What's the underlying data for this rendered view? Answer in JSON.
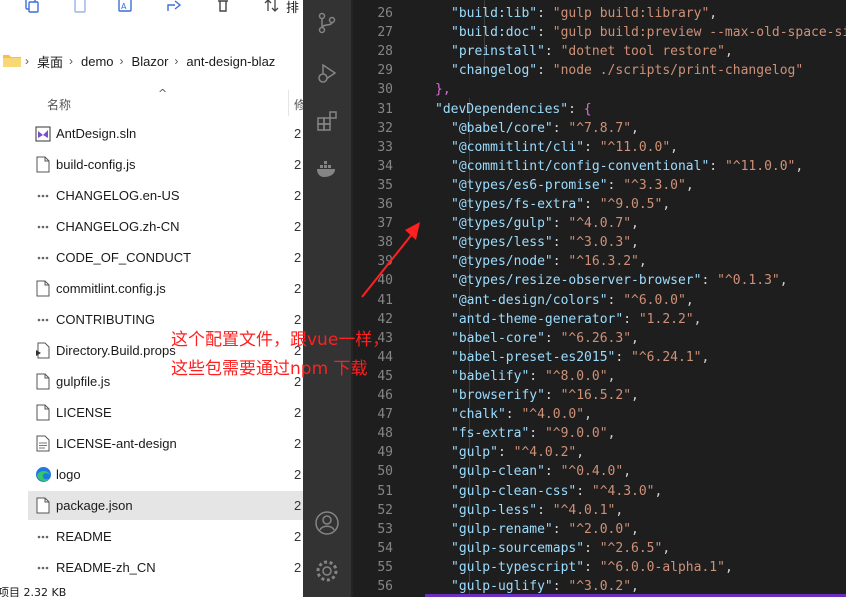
{
  "explorer": {
    "toolbar": {
      "sort_label": "排"
    },
    "breadcrumb": [
      "桌面",
      "demo",
      "Blazor",
      "ant-design-blaz"
    ],
    "column_name": "名称",
    "column_modified": "修",
    "files": [
      {
        "name": "AntDesign.sln",
        "icon": "vs-solution-icon",
        "date": "2"
      },
      {
        "name": "build-config.js",
        "icon": "file-icon",
        "date": "2"
      },
      {
        "name": "CHANGELOG.en-US",
        "icon": "text-file-icon",
        "date": "2"
      },
      {
        "name": "CHANGELOG.zh-CN",
        "icon": "text-file-icon",
        "date": "2"
      },
      {
        "name": "CODE_OF_CONDUCT",
        "icon": "text-file-icon",
        "date": "2"
      },
      {
        "name": "commitlint.config.js",
        "icon": "file-icon",
        "date": "2"
      },
      {
        "name": "CONTRIBUTING",
        "icon": "text-file-icon",
        "date": "2"
      },
      {
        "name": "Directory.Build.props",
        "icon": "props-file-icon",
        "date": "2"
      },
      {
        "name": "gulpfile.js",
        "icon": "file-icon",
        "date": "2"
      },
      {
        "name": "LICENSE",
        "icon": "file-icon",
        "date": "2"
      },
      {
        "name": "LICENSE-ant-design",
        "icon": "doc-file-icon",
        "date": "2"
      },
      {
        "name": "logo",
        "icon": "edge-icon",
        "date": "2"
      },
      {
        "name": "package.json",
        "icon": "file-icon",
        "date": "2",
        "selected": true
      },
      {
        "name": "README",
        "icon": "text-file-icon",
        "date": "2"
      },
      {
        "name": "README-zh_CN",
        "icon": "text-file-icon",
        "date": "2"
      }
    ],
    "status": "项目 2.32 KB"
  },
  "vscode": {
    "lines": [
      {
        "n": "26",
        "key": "\"build:lib\"",
        "val": "\"gulp build:library\"",
        "tail": ","
      },
      {
        "n": "27",
        "key": "\"build:doc\"",
        "val": "\"gulp build:preview --max-old-space-siz",
        "tail": ""
      },
      {
        "n": "28",
        "key": "\"preinstall\"",
        "val": "\"dotnet tool restore\"",
        "tail": ","
      },
      {
        "n": "29",
        "key": "\"changelog\"",
        "val": "\"node ./scripts/print-changelog\"",
        "tail": ""
      },
      {
        "n": "30",
        "raw": "},",
        "rawclass": "brace",
        "indent": 0
      },
      {
        "n": "31",
        "key": "\"devDependencies\"",
        "val": "{",
        "valclass": "brace",
        "tail": "",
        "indent": 0
      },
      {
        "n": "32",
        "key": "\"@babel/core\"",
        "val": "\"^7.8.7\"",
        "tail": ","
      },
      {
        "n": "33",
        "key": "\"@commitlint/cli\"",
        "val": "\"^11.0.0\"",
        "tail": ","
      },
      {
        "n": "34",
        "key": "\"@commitlint/config-conventional\"",
        "val": "\"^11.0.0\"",
        "tail": ","
      },
      {
        "n": "35",
        "key": "\"@types/es6-promise\"",
        "val": "\"^3.3.0\"",
        "tail": ","
      },
      {
        "n": "36",
        "key": "\"@types/fs-extra\"",
        "val": "\"^9.0.5\"",
        "tail": ","
      },
      {
        "n": "37",
        "key": "\"@types/gulp\"",
        "val": "\"^4.0.7\"",
        "tail": ","
      },
      {
        "n": "38",
        "key": "\"@types/less\"",
        "val": "\"^3.0.3\"",
        "tail": ","
      },
      {
        "n": "39",
        "key": "\"@types/node\"",
        "val": "\"^16.3.2\"",
        "tail": ","
      },
      {
        "n": "40",
        "key": "\"@types/resize-observer-browser\"",
        "val": "\"^0.1.3\"",
        "tail": ","
      },
      {
        "n": "41",
        "key": "\"@ant-design/colors\"",
        "val": "\"^6.0.0\"",
        "tail": ","
      },
      {
        "n": "42",
        "key": "\"antd-theme-generator\"",
        "val": "\"1.2.2\"",
        "tail": ","
      },
      {
        "n": "43",
        "key": "\"babel-core\"",
        "val": "\"^6.26.3\"",
        "tail": ","
      },
      {
        "n": "44",
        "key": "\"babel-preset-es2015\"",
        "val": "\"^6.24.1\"",
        "tail": ","
      },
      {
        "n": "45",
        "key": "\"babelify\"",
        "val": "\"^8.0.0\"",
        "tail": ","
      },
      {
        "n": "46",
        "key": "\"browserify\"",
        "val": "\"^16.5.2\"",
        "tail": ","
      },
      {
        "n": "47",
        "key": "\"chalk\"",
        "val": "\"^4.0.0\"",
        "tail": ","
      },
      {
        "n": "48",
        "key": "\"fs-extra\"",
        "val": "\"^9.0.0\"",
        "tail": ","
      },
      {
        "n": "49",
        "key": "\"gulp\"",
        "val": "\"^4.0.2\"",
        "tail": ","
      },
      {
        "n": "50",
        "key": "\"gulp-clean\"",
        "val": "\"^0.4.0\"",
        "tail": ","
      },
      {
        "n": "51",
        "key": "\"gulp-clean-css\"",
        "val": "\"^4.3.0\"",
        "tail": ","
      },
      {
        "n": "52",
        "key": "\"gulp-less\"",
        "val": "\"^4.0.1\"",
        "tail": ","
      },
      {
        "n": "53",
        "key": "\"gulp-rename\"",
        "val": "\"^2.0.0\"",
        "tail": ","
      },
      {
        "n": "54",
        "key": "\"gulp-sourcemaps\"",
        "val": "\"^2.6.5\"",
        "tail": ","
      },
      {
        "n": "55",
        "key": "\"gulp-typescript\"",
        "val": "\"^6.0.0-alpha.1\"",
        "tail": ","
      },
      {
        "n": "56",
        "key": "\"gulp-uglify\"",
        "val": "\"^3.0.2\"",
        "tail": ","
      }
    ],
    "activity_icons": [
      "source-control-icon",
      "run-debug-icon",
      "extensions-icon",
      "docker-icon",
      "account-icon",
      "settings-gear-icon"
    ]
  },
  "annotation": {
    "line1": "这个配置文件，跟vue一样，",
    "line2": "这些包需要通过npm 下载",
    "color": "#ff2020"
  }
}
